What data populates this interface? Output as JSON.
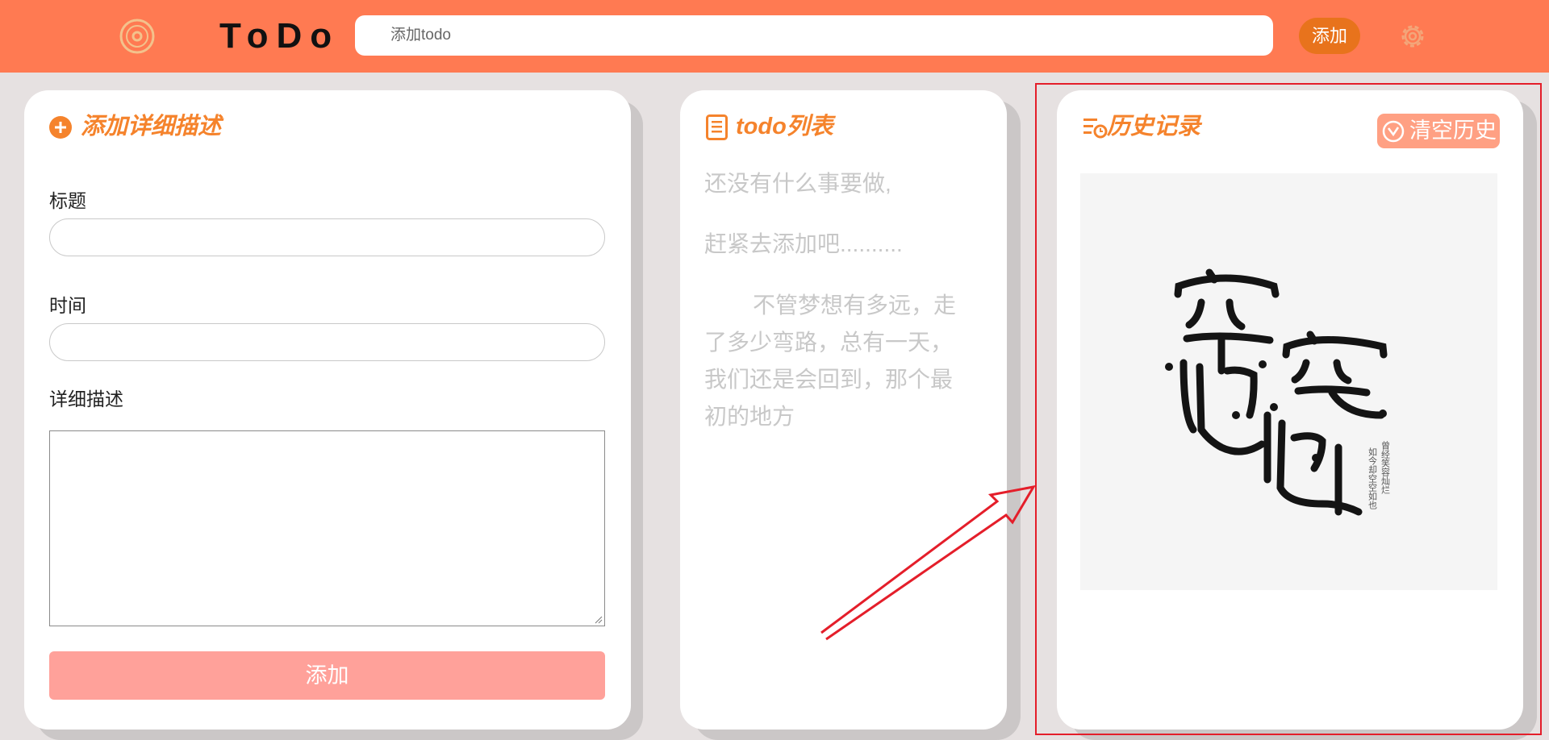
{
  "header": {
    "app_title": "ToDo",
    "search_placeholder": "添加todo",
    "add_label": "添加",
    "logo_icon": "vinyl-disc-icon",
    "settings_icon": "gear-icon"
  },
  "detail_panel": {
    "title": "添加详细描述",
    "title_icon": "plus-circle-icon",
    "title_label": "标题",
    "time_label": "时间",
    "desc_label": "详细描述",
    "submit_label": "添加"
  },
  "todo_panel": {
    "title": "todo列表",
    "title_icon": "list-icon",
    "empty_line1": "还没有什么事要做,",
    "empty_line2": "赶紧去添加吧..........",
    "quote_lines": [
      "不管梦想有多远，走",
      "了多少弯路，总有一天，",
      "我们还是会回到，那个最",
      "初的地方"
    ]
  },
  "history_panel": {
    "title": "历史记录",
    "title_icon": "history-list-icon",
    "clear_label": "清空历史",
    "clear_icon": "broom-icon",
    "art_main_chars": [
      "空",
      "空",
      "也",
      "也"
    ],
    "art_poem_col1": "曾经笑容灿烂",
    "art_poem_col2": "如今却空空如也"
  },
  "colors": {
    "header_bg": "#ff7a52",
    "accent": "#f5832c",
    "add_button": "#e8731c",
    "submit_button": "#ffa19a",
    "highlight": "#e41e2a",
    "page_bg": "#e6e1e1"
  }
}
